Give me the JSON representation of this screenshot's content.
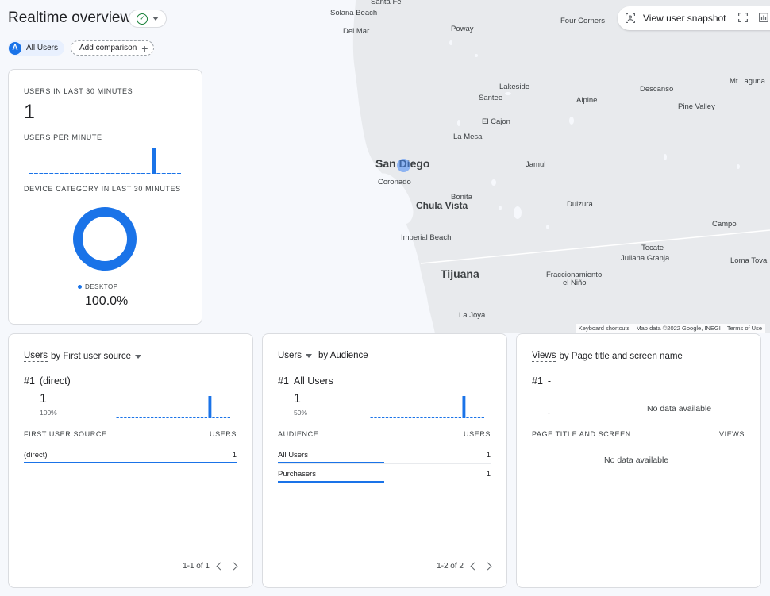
{
  "header": {
    "title": "Realtime overview",
    "all_users_badge": "A",
    "all_users_label": "All Users",
    "add_comparison_label": "Add comparison",
    "snapshot_label": "View user snapshot"
  },
  "map": {
    "labels": {
      "santa_fe": "Santa Fe",
      "solana_beach": "Solana Beach",
      "del_mar": "Del Mar",
      "poway": "Poway",
      "four_corners": "Four Corners",
      "lakeside": "Lakeside",
      "santee": "Santee",
      "alpine": "Alpine",
      "descanso": "Descanso",
      "mt_laguna": "Mt Laguna",
      "pine_valley": "Pine Valley",
      "el_cajon": "El Cajon",
      "la_mesa": "La Mesa",
      "san_diego": "San Diego",
      "coronado": "Coronado",
      "jamul": "Jamul",
      "bonita": "Bonita",
      "chula_vista": "Chula Vista",
      "dulzura": "Dulzura",
      "campo": "Campo",
      "imperial_beach": "Imperial Beach",
      "tecate": "Tecate",
      "juliana_granja": "Juliana Granja",
      "loma_tova": "Loma Tova",
      "tijuana": "Tijuana",
      "fraccionamiento": "Fraccionamiento",
      "el_nino": "el Niño",
      "la_joya": "La Joya"
    },
    "attribution": {
      "keyboard": "Keyboard shortcuts",
      "data": "Map data ©2022 Google, INEGI",
      "terms": "Terms of Use"
    }
  },
  "summary": {
    "users_30_label": "USERS IN LAST 30 MINUTES",
    "users_30_value": "1",
    "users_per_minute_label": "USERS PER MINUTE",
    "device_label": "DEVICE CATEGORY IN LAST 30 MINUTES",
    "device_legend": "DESKTOP",
    "device_pct": "100.0%",
    "per_minute_values": [
      0,
      0,
      0,
      0,
      0,
      0,
      0,
      0,
      0,
      0,
      0,
      0,
      0,
      0,
      0,
      0,
      0,
      0,
      0,
      0,
      0,
      0,
      0,
      0,
      1,
      0,
      0,
      0,
      0,
      0
    ],
    "device_share": 1.0,
    "accent": "#1a73e8"
  },
  "source_card": {
    "title_metric": "Users",
    "title_rest": "by First user source",
    "rank": "#1",
    "rank_label": "(direct)",
    "count": "1",
    "pct": "100%",
    "col_left": "FIRST USER SOURCE",
    "col_right": "USERS",
    "rows": [
      {
        "label": "(direct)",
        "value": "1",
        "share": 1.0
      }
    ],
    "pager": "1-1 of 1",
    "spark_values": [
      0,
      0,
      0,
      0,
      0,
      0,
      0,
      0,
      0,
      0,
      0,
      0,
      0,
      0,
      0,
      0,
      0,
      0,
      0,
      0,
      0,
      0,
      0,
      0,
      1,
      0,
      0,
      0,
      0,
      0
    ]
  },
  "audience_card": {
    "title_metric": "Users",
    "title_rest": "by Audience",
    "rank": "#1",
    "rank_label": "All Users",
    "count": "1",
    "pct": "50%",
    "col_left": "AUDIENCE",
    "col_right": "USERS",
    "rows": [
      {
        "label": "All Users",
        "value": "1",
        "share": 0.5
      },
      {
        "label": "Purchasers",
        "value": "1",
        "share": 0.5
      }
    ],
    "pager": "1-2 of 2",
    "spark_values": [
      0,
      0,
      0,
      0,
      0,
      0,
      0,
      0,
      0,
      0,
      0,
      0,
      0,
      0,
      0,
      0,
      0,
      0,
      0,
      0,
      0,
      0,
      0,
      0,
      1,
      0,
      0,
      0,
      0,
      0
    ]
  },
  "views_card": {
    "title_metric": "Views",
    "title_rest": "by Page title and screen name",
    "rank": "#1",
    "rank_label": "-",
    "dash": "-",
    "no_data_top": "No data available",
    "col_left": "PAGE TITLE AND SCREEN…",
    "col_right": "VIEWS",
    "no_data_table": "No data available"
  }
}
